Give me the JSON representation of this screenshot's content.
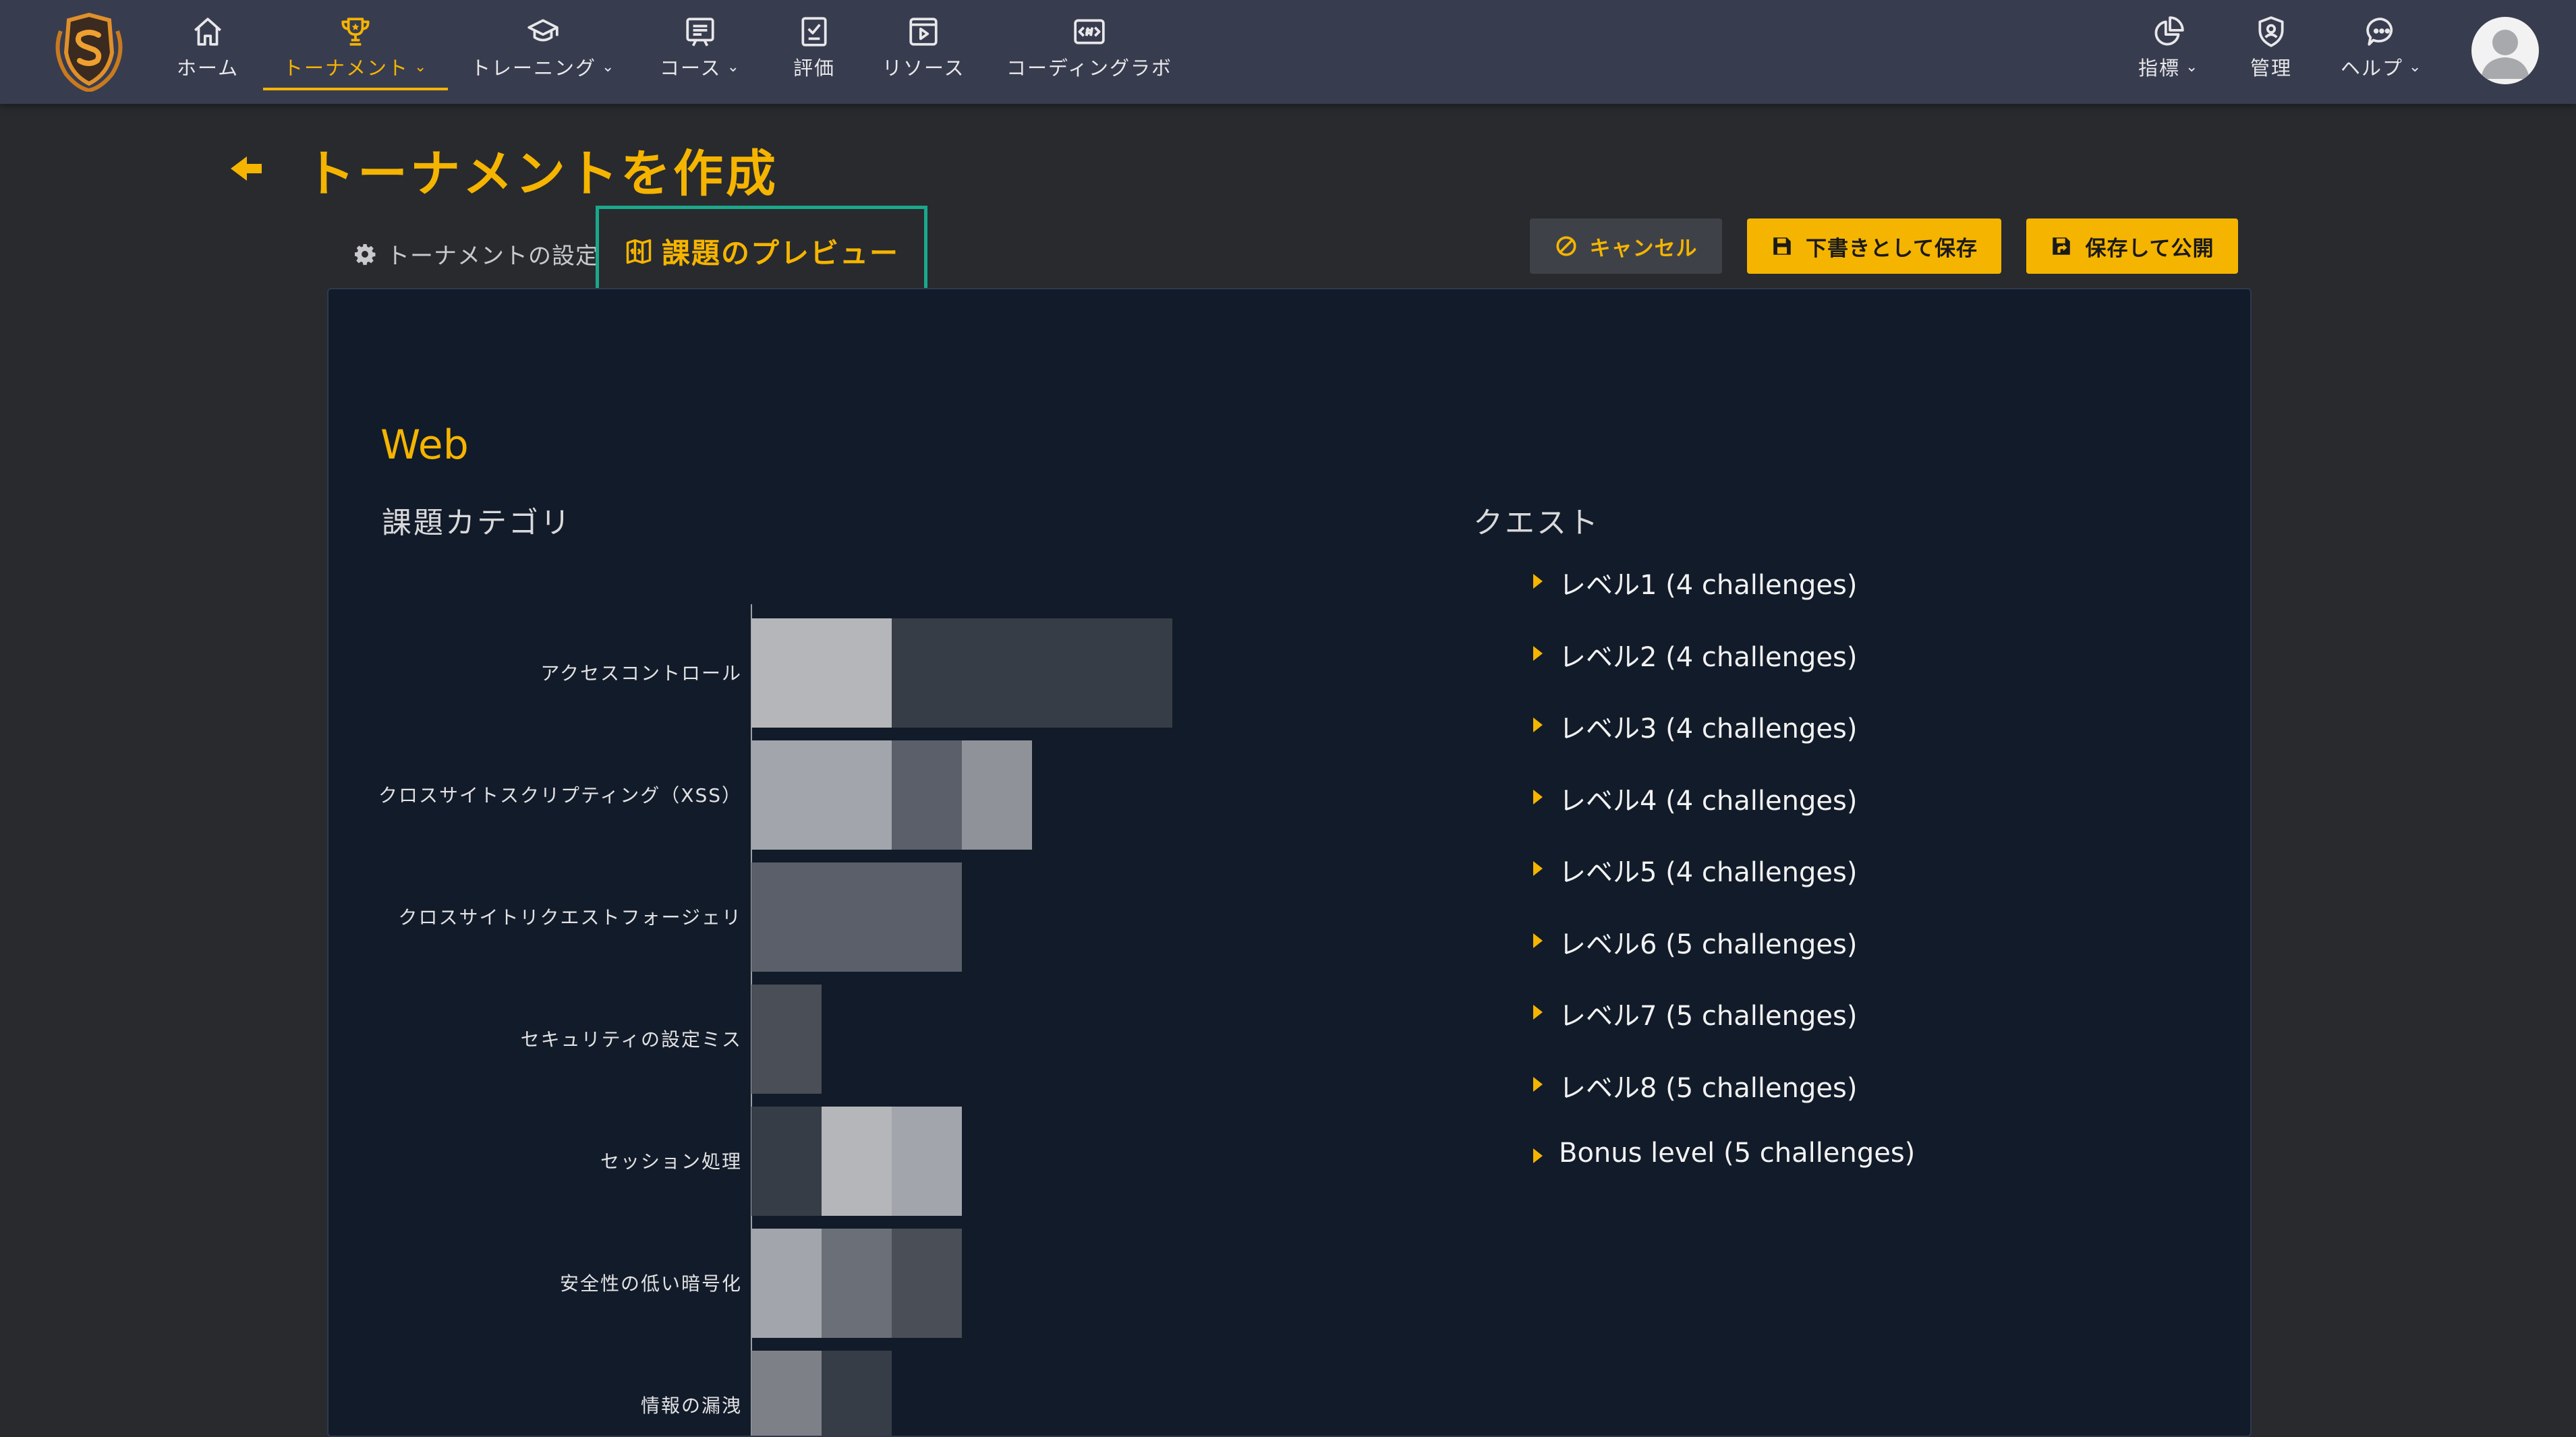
{
  "nav": {
    "items": [
      {
        "key": "home",
        "label": "ホーム",
        "icon": "home-icon",
        "dropdown": false,
        "active": false
      },
      {
        "key": "tournament",
        "label": "トーナメント",
        "icon": "trophy-icon",
        "dropdown": true,
        "active": true
      },
      {
        "key": "training",
        "label": "トレーニング",
        "icon": "graduation-cap-icon",
        "dropdown": true,
        "active": false
      },
      {
        "key": "courses",
        "label": "コース",
        "icon": "course-icon",
        "dropdown": true,
        "active": false
      },
      {
        "key": "assessment",
        "label": "評価",
        "icon": "clipboard-check-icon",
        "dropdown": false,
        "active": false
      },
      {
        "key": "resources",
        "label": "リソース",
        "icon": "video-icon",
        "dropdown": false,
        "active": false
      },
      {
        "key": "coding-lab",
        "label": "コーディングラボ",
        "icon": "code-lab-icon",
        "dropdown": false,
        "active": false
      }
    ],
    "right_items": [
      {
        "key": "metrics",
        "label": "指標",
        "icon": "pie-chart-icon",
        "dropdown": true
      },
      {
        "key": "admin",
        "label": "管理",
        "icon": "admin-shield-icon",
        "dropdown": false
      },
      {
        "key": "help",
        "label": "ヘルプ",
        "icon": "chat-bubble-icon",
        "dropdown": true
      }
    ]
  },
  "page": {
    "title": "トーナメントを作成",
    "tabs": {
      "settings": "トーナメントの設定",
      "preview": "課題のプレビュー"
    },
    "buttons": {
      "cancel": "キャンセル",
      "save_draft": "下書きとして保存",
      "save_publish": "保存して公開"
    }
  },
  "panel": {
    "section_title": "Web",
    "category_heading": "課題カテゴリ",
    "quest_heading": "クエスト",
    "quests": [
      "レベル1 (4 challenges)",
      "レベル2 (4 challenges)",
      "レベル3 (4 challenges)",
      "レベル4 (4 challenges)",
      "レベル5 (4 challenges)",
      "レベル6 (5 challenges)",
      "レベル7 (5 challenges)",
      "レベル8 (5 challenges)",
      "Bonus level (5 challenges)"
    ]
  },
  "colors": {
    "accent": "#f5b400",
    "navbar": "#383c4f",
    "panel": "#121b29",
    "tab_border": "#1aa88c"
  },
  "chart_data": {
    "type": "bar",
    "orientation": "horizontal",
    "stacked": true,
    "categories": [
      "アクセスコントロール",
      "クロスサイトスクリプティング（XSS）",
      "クロスサイトリクエストフォージェリ",
      "セキュリティの設定ミス",
      "セッション処理",
      "安全性の低い暗号化",
      "情報の漏洩"
    ],
    "segments": [
      [
        {
          "value": 2,
          "color": "#b5b6ba"
        },
        {
          "value": 4,
          "color": "#373d47"
        }
      ],
      [
        {
          "value": 2,
          "color": "#a2a5ab"
        },
        {
          "value": 1,
          "color": "#5a5f69"
        },
        {
          "value": 1,
          "color": "#8f9298"
        }
      ],
      [
        {
          "value": 3,
          "color": "#5a5f69"
        }
      ],
      [
        {
          "value": 1,
          "color": "#494e57"
        }
      ],
      [
        {
          "value": 1,
          "color": "#373d47"
        },
        {
          "value": 1,
          "color": "#b5b6ba"
        },
        {
          "value": 1,
          "color": "#a2a5ab"
        }
      ],
      [
        {
          "value": 1,
          "color": "#a2a5ab"
        },
        {
          "value": 1,
          "color": "#6b6f77"
        },
        {
          "value": 1,
          "color": "#494e57"
        }
      ],
      [
        {
          "value": 1,
          "color": "#7d8087"
        },
        {
          "value": 1,
          "color": "#373d47"
        }
      ]
    ]
  }
}
